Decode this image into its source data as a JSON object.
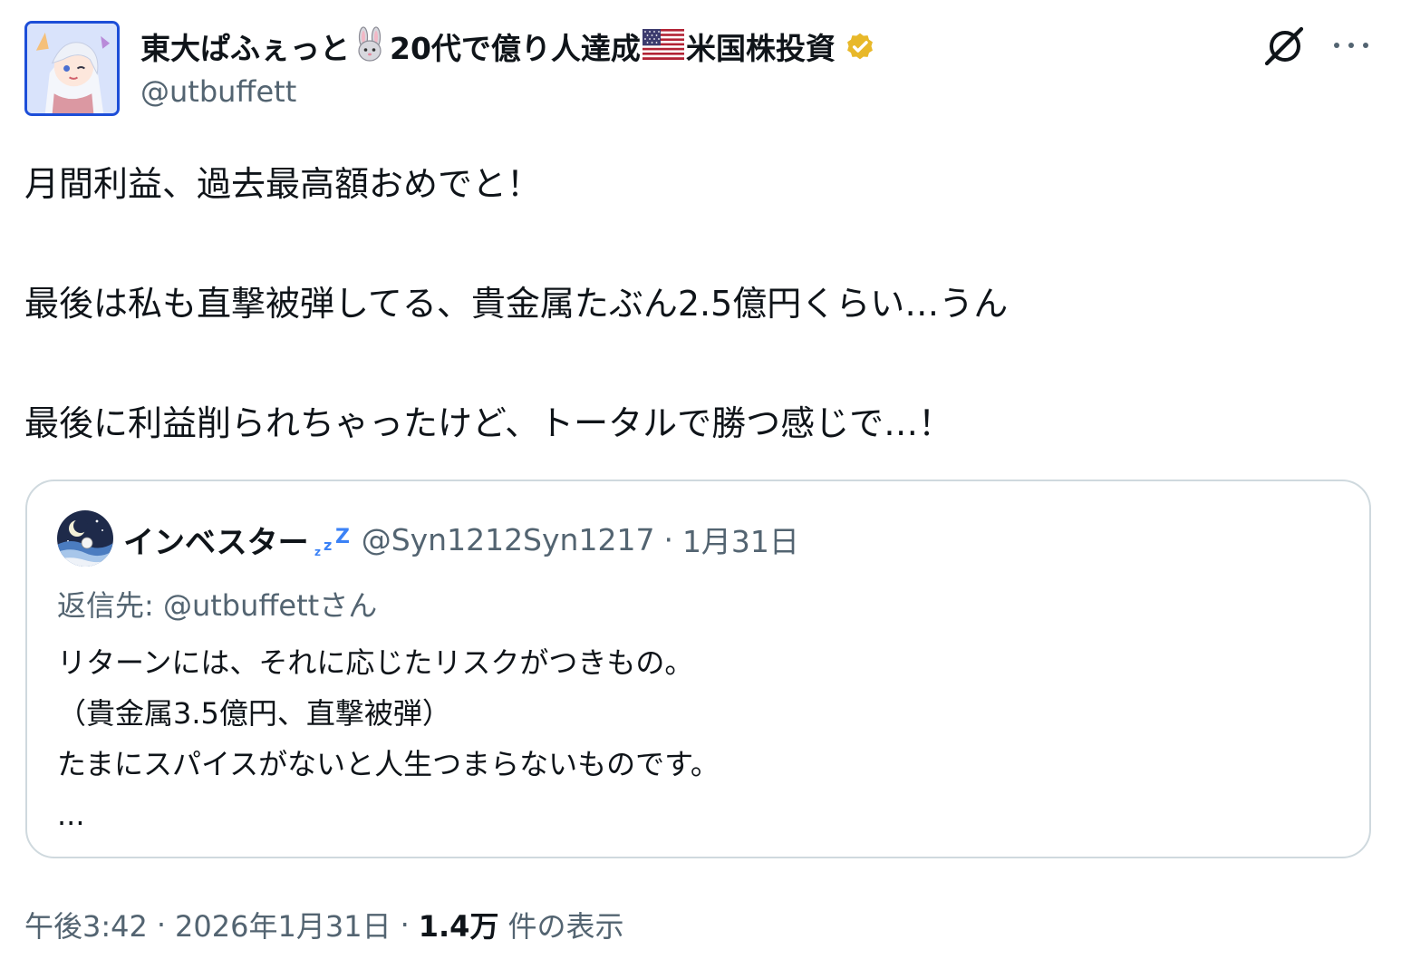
{
  "author": {
    "display_name_part1": "東大ぱふぇっと",
    "name_emoji1": "rabbit-face-emoji",
    "display_name_part2": "20代で億り人達成",
    "name_emoji2": "us-flag-emoji",
    "display_name_part3": "米国株投資",
    "verified_icon": "verified-badge-icon",
    "handle": "@utbuffett"
  },
  "header_actions": {
    "grok_icon": "grok-icon",
    "more_icon": "more-icon"
  },
  "tweet": {
    "lines": [
      "月間利益、過去最高額おめでと！",
      "",
      "最後は私も直撃被弾してる、貴金属たぶん2.5億円くらい…うん",
      "",
      "最後に利益削られちゃったけど、トータルで勝つ感じで…！"
    ]
  },
  "quote": {
    "name": "インベスター",
    "name_emoji": "zzz-emoji",
    "handle": "@Syn1212Syn1217",
    "separator": "·",
    "date": "1月31日",
    "reply_to": "返信先: @utbuffettさん",
    "lines": [
      "リターンには、それに応じたリスクがつきもの。",
      "（貴金属3.5億円、直撃被弾）",
      "たまにスパイスがないと人生つまらないものです。",
      "..."
    ]
  },
  "footer": {
    "time": "午後3:42",
    "sep1": "·",
    "date": "2026年1月31日",
    "sep2": "·",
    "views_count": "1.4万",
    "views_label": "件の表示"
  },
  "colors": {
    "text_primary": "#0f1419",
    "text_secondary": "#536471",
    "border": "#cfd9de",
    "verified_gold": "#e8b829",
    "zzz_blue": "#3b82f6"
  }
}
